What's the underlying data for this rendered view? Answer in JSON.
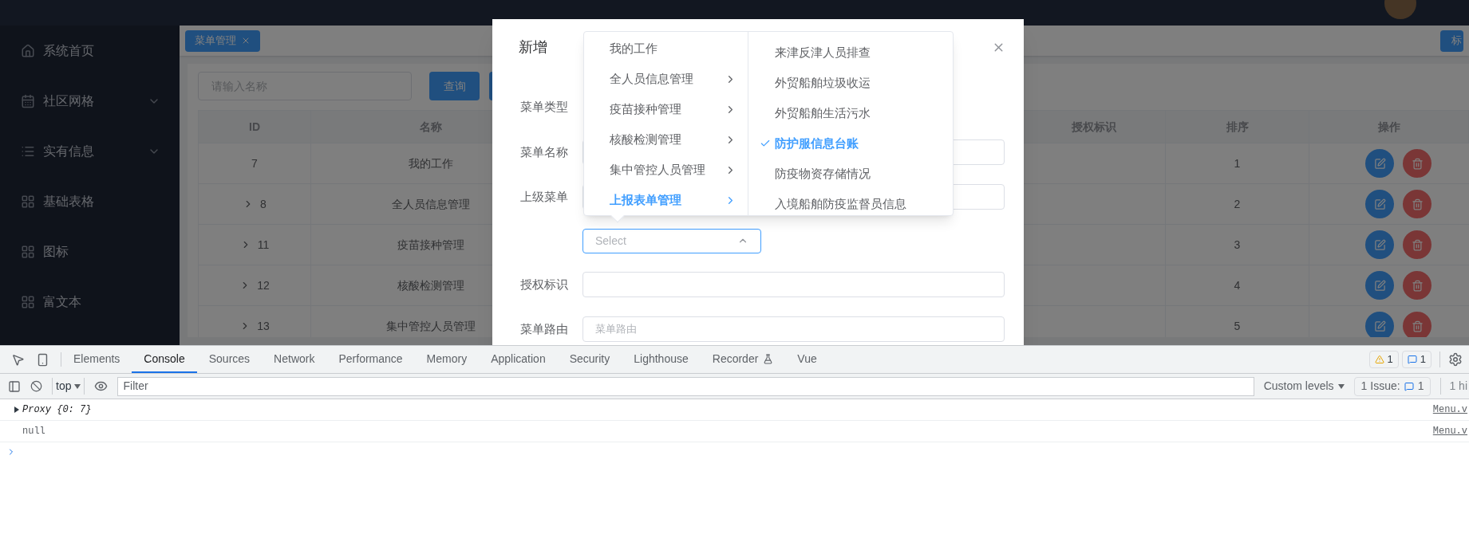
{
  "sidebar": {
    "items": [
      {
        "label": "系统首页",
        "expandable": false
      },
      {
        "label": "社区网格",
        "expandable": true
      },
      {
        "label": "实有信息",
        "expandable": true
      },
      {
        "label": "基础表格",
        "expandable": false
      },
      {
        "label": "图标",
        "expandable": false
      },
      {
        "label": "富文本",
        "expandable": false
      }
    ]
  },
  "tabs": [
    {
      "label": "菜单管理",
      "selected": true
    }
  ],
  "right_tag": "标",
  "search": {
    "placeholder": "请输入名称",
    "button": "查询"
  },
  "table": {
    "columns": [
      "ID",
      "名称",
      "授权标识",
      "排序",
      "操作"
    ],
    "rows": [
      {
        "id": "7",
        "name": "我的工作",
        "sort": "1",
        "expandable": false
      },
      {
        "id": "8",
        "name": "全人员信息管理",
        "sort": "2",
        "expandable": true
      },
      {
        "id": "11",
        "name": "疫苗接种管理",
        "sort": "3",
        "expandable": true
      },
      {
        "id": "12",
        "name": "核酸检测管理",
        "sort": "4",
        "expandable": true
      },
      {
        "id": "13",
        "name": "集中管控人员管理",
        "sort": "5",
        "expandable": true
      }
    ]
  },
  "dialog": {
    "title": "新增",
    "fields": [
      {
        "label": "菜单类型",
        "kind": "hidden"
      },
      {
        "label": "菜单名称",
        "kind": "input"
      },
      {
        "label": "上级菜单",
        "kind": "input"
      },
      {
        "kind": "select",
        "placeholder": "Select"
      },
      {
        "label": "授权标识",
        "kind": "input"
      },
      {
        "label": "菜单路由",
        "kind": "input",
        "placeholder": "菜单路由"
      }
    ],
    "cascader": {
      "left": [
        {
          "label": "我的工作",
          "has_children": false,
          "selected": false
        },
        {
          "label": "全人员信息管理",
          "has_children": true,
          "selected": false
        },
        {
          "label": "疫苗接种管理",
          "has_children": true,
          "selected": false
        },
        {
          "label": "核酸检测管理",
          "has_children": true,
          "selected": false
        },
        {
          "label": "集中管控人员管理",
          "has_children": true,
          "selected": false
        },
        {
          "label": "上报表单管理",
          "has_children": true,
          "selected": true
        }
      ],
      "right": [
        {
          "label": "来津反津人员排查",
          "checked": false
        },
        {
          "label": "外贸船舶垃圾收运",
          "checked": false
        },
        {
          "label": "外贸船舶生活污水",
          "checked": false
        },
        {
          "label": "防护服信息台账",
          "checked": true
        },
        {
          "label": "防疫物资存储情况",
          "checked": false
        },
        {
          "label": "入境船舶防疫监督员信息",
          "checked": false
        }
      ]
    }
  },
  "devtools": {
    "tabs": [
      {
        "label": "Elements",
        "selected": false
      },
      {
        "label": "Console",
        "selected": true
      },
      {
        "label": "Sources",
        "selected": false
      },
      {
        "label": "Network",
        "selected": false
      },
      {
        "label": "Performance",
        "selected": false
      },
      {
        "label": "Memory",
        "selected": false
      },
      {
        "label": "Application",
        "selected": false
      },
      {
        "label": "Security",
        "selected": false
      },
      {
        "label": "Lighthouse",
        "selected": false
      },
      {
        "label": "Recorder",
        "selected": false,
        "experimental": true
      },
      {
        "label": "Vue",
        "selected": false
      }
    ],
    "warnings": "1",
    "messages": "1",
    "context": "top",
    "filter_placeholder": "Filter",
    "levels": "Custom levels",
    "issues_label": "1 Issue:",
    "issues_count": "1",
    "hidden": "1 hi",
    "console": [
      {
        "kind": "object",
        "text": "Proxy {0: 7}",
        "source": "Menu.v"
      },
      {
        "kind": "value",
        "text": "null",
        "source": "Menu.v"
      }
    ]
  }
}
